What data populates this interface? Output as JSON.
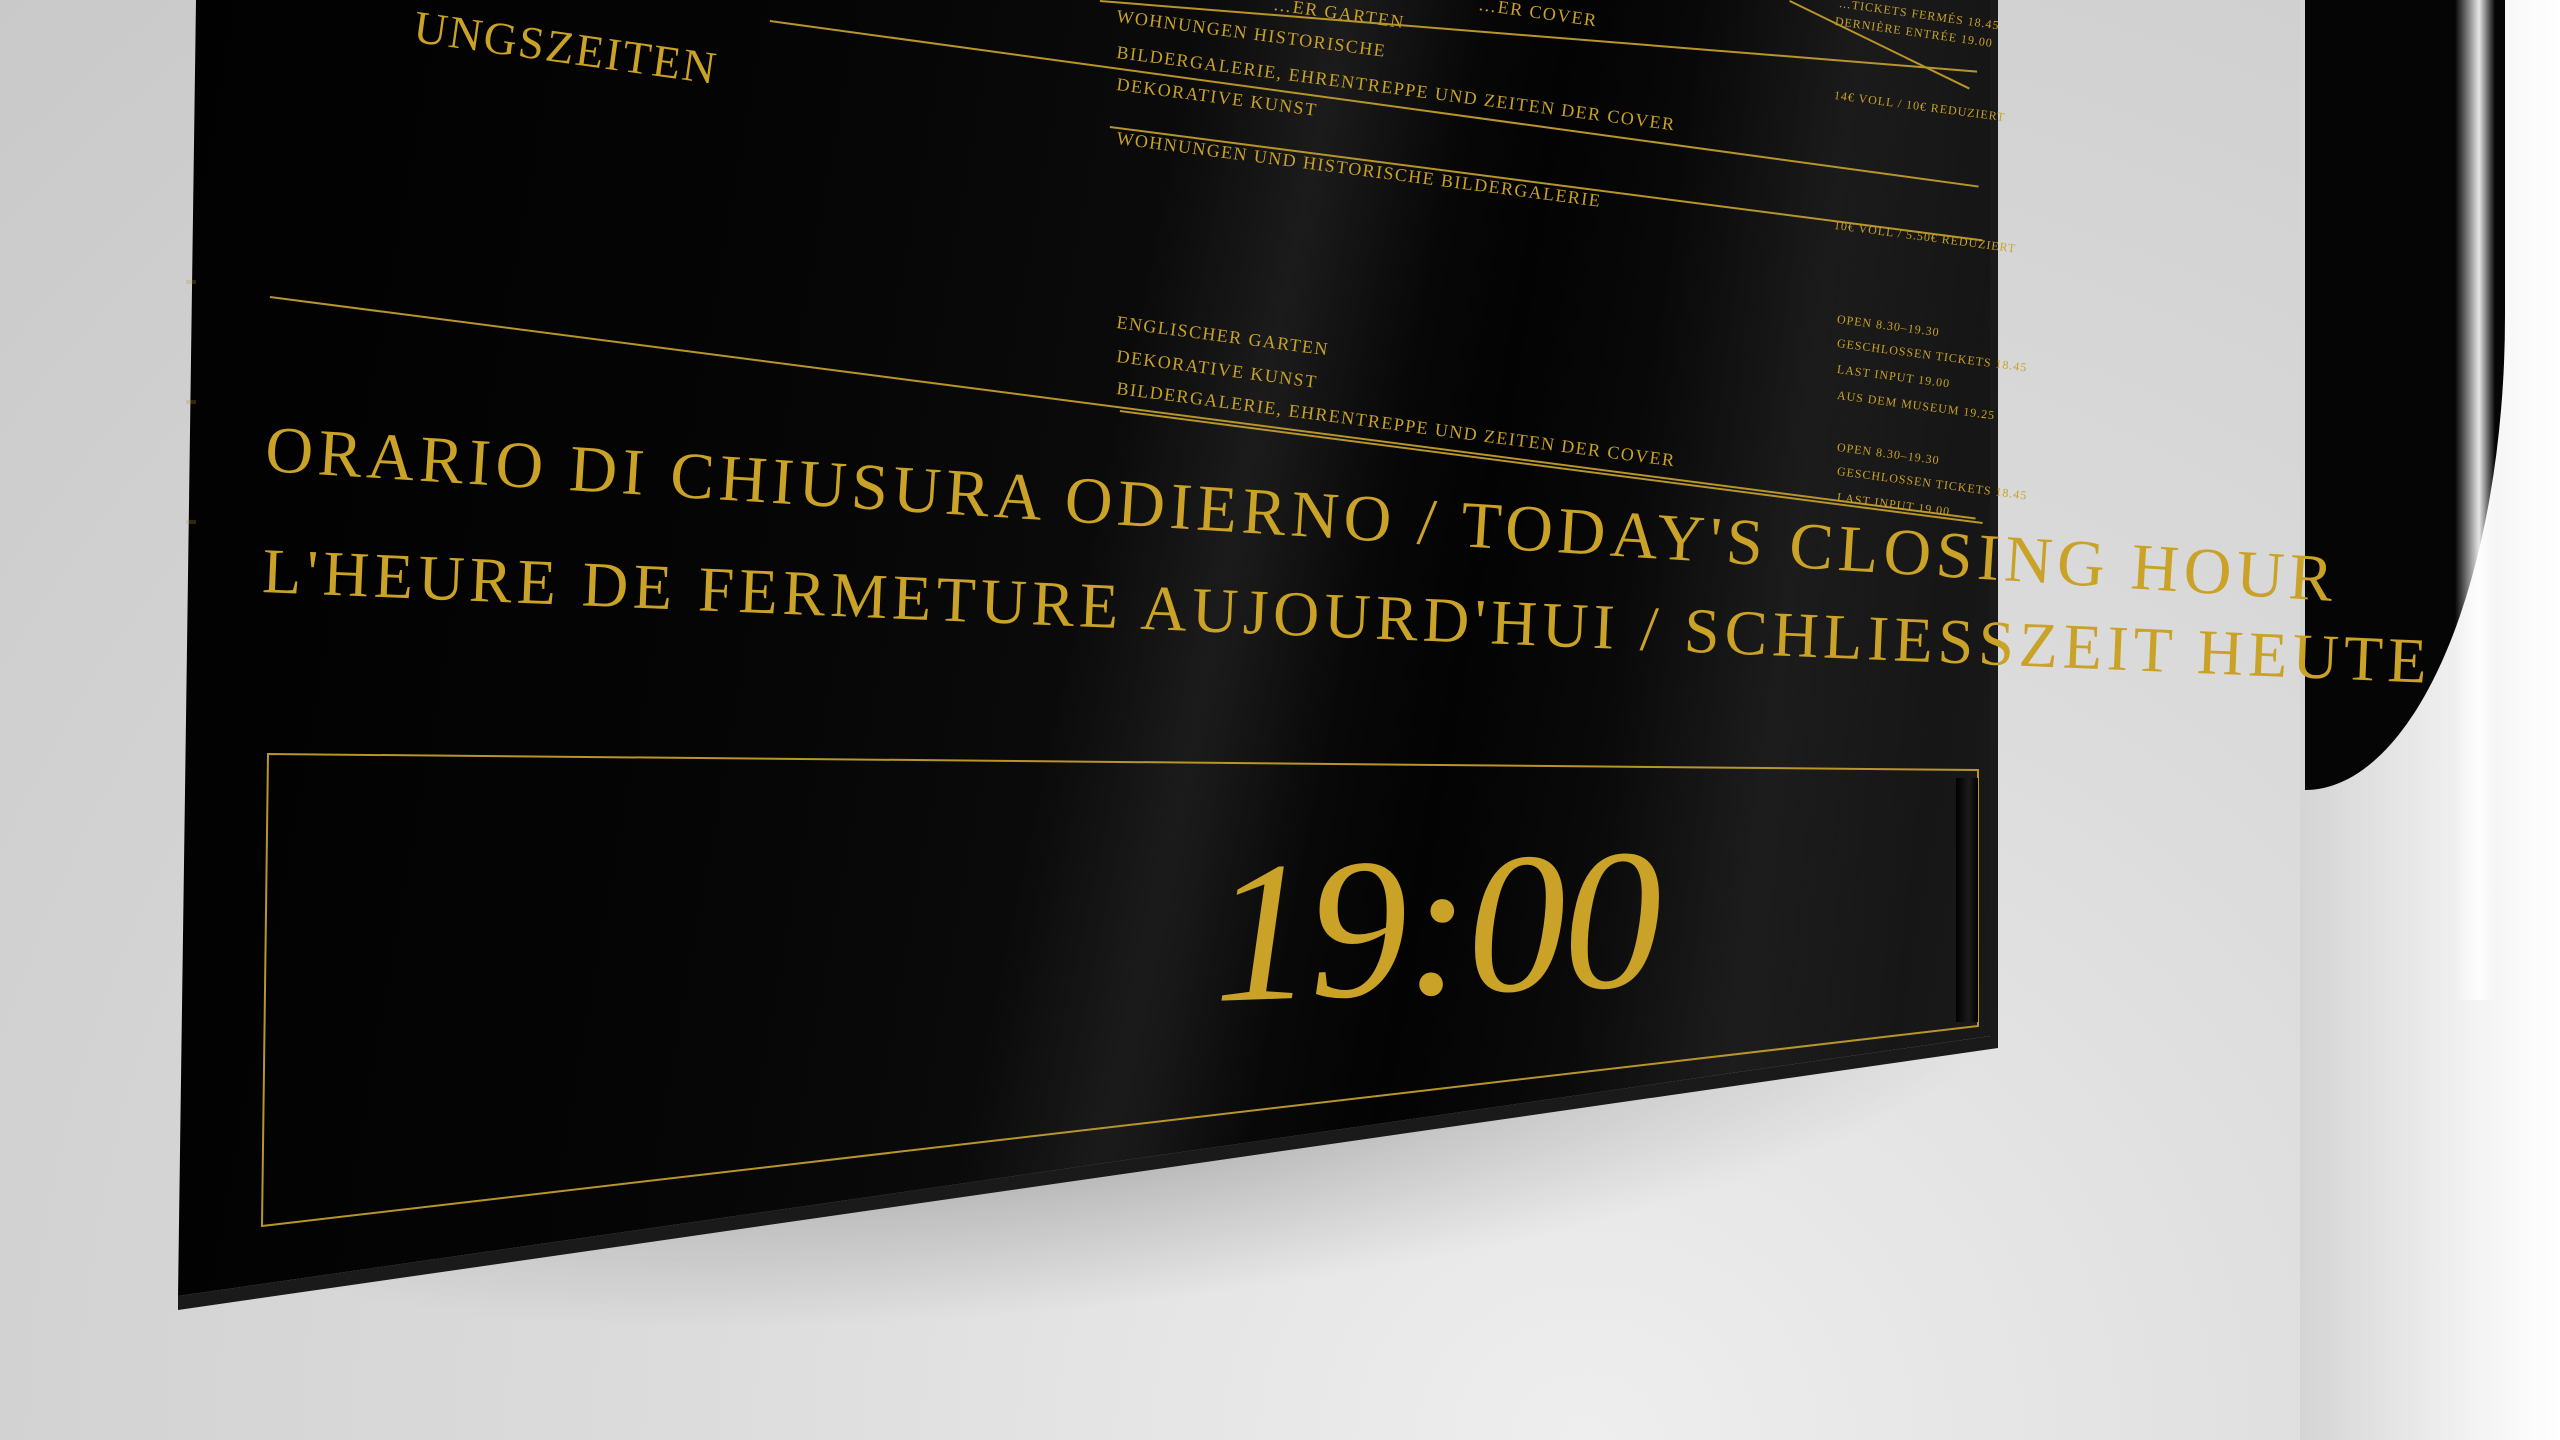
{
  "sign": {
    "heading_partial": "UNGSZEITEN",
    "rows": [
      {
        "label": "…ER GARTEN",
        "info": "…GESCHLOSSEN TICKETS 18.45"
      },
      {
        "label": "WOHNUNGEN HISTORISCHE",
        "info": "DERNIÈRE ENTRÉE 19.00"
      },
      {
        "label": "BILDERGALERIE, EHRENTREPPE UND ZEITEN DER COVER",
        "info": "14€ VOLL / 10€ REDUZIERT"
      },
      {
        "label": "DEKORATIVE KUNST",
        "info": ""
      },
      {
        "label": "WOHNUNGEN UND HISTORISCHE BILDERGALERIE",
        "info": "10€ VOLL / 5.50€ REDUZIERT"
      },
      {
        "label": "ENGLISCHER GARTEN",
        "info": "OPEN 8.30–19.30"
      },
      {
        "label": "DEKORATIVE KUNST",
        "info": "GESCHLOSSEN TICKETS 18.45"
      },
      {
        "label": "BILDERGALERIE, EHRENTREPPE UND ZEITEN DER COVER",
        "info": "LAST INPUT 19.00"
      }
    ],
    "extra_info": [
      "AUS DEM MUSEUM 19.25",
      "OPEN 8.30–19.30",
      "GESCHLOSSEN TICKETS 18.45",
      "LAST INPUT 19.00"
    ],
    "top_right_info": [
      "…TICKETS FERMÉS 18.45",
      "DERNIÈRE ENTRÉE 19.00"
    ],
    "top_cover_text": "…ER COVER",
    "closing_heading_line1": "ORARIO DI CHIUSURA ODIERNO / TODAY'S CLOSING HOUR",
    "closing_heading_line2": "L'HEURE DE FERMETURE AUJOURD'HUI / SCHLIEßZEIT HEUTE",
    "closing_time": "19:00"
  },
  "colors": {
    "gold": "#c9a227",
    "panel": "#000000",
    "wall": "#d9d9d9"
  }
}
